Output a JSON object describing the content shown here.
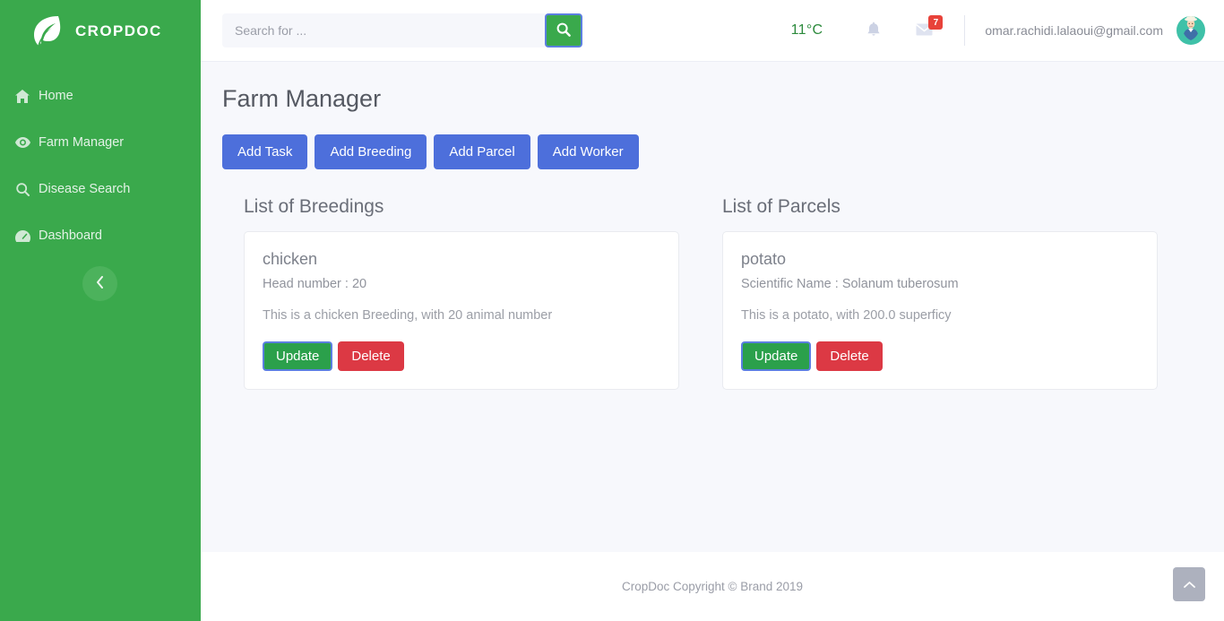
{
  "sidebar": {
    "brand": {
      "name": "CROPDOC",
      "logo_icon": "leaf-icon"
    },
    "items": [
      {
        "label": "Home",
        "icon": "home-icon"
      },
      {
        "label": "Farm Manager",
        "icon": "eye-icon"
      },
      {
        "label": "Disease Search",
        "icon": "search-icon"
      },
      {
        "label": "Dashboard",
        "icon": "dashboard-icon"
      }
    ],
    "collapse_icon": "chevron-left-icon",
    "bg_color": "#3aa94c"
  },
  "topbar": {
    "search": {
      "placeholder": "Search for ...",
      "value": "",
      "button_icon": "search-icon"
    },
    "temperature": "11°C",
    "notifications_icon": "bell-icon",
    "messages_icon": "envelope-icon",
    "messages_badge": "7",
    "user_email": "omar.rachidi.lalaoui@gmail.com",
    "avatar_icon": "farmer-avatar-icon"
  },
  "main": {
    "page_title": "Farm Manager",
    "actions": [
      {
        "label": "Add Task"
      },
      {
        "label": "Add Breeding"
      },
      {
        "label": "Add Parcel"
      },
      {
        "label": "Add Worker"
      }
    ],
    "breedings": {
      "title": "List of Breedings",
      "cards": [
        {
          "name": "chicken",
          "subtitle": "Head number : 20",
          "description": "This is a chicken Breeding, with 20 animal number",
          "update_label": "Update",
          "delete_label": "Delete"
        }
      ]
    },
    "parcels": {
      "title": "List of Parcels",
      "cards": [
        {
          "name": "potato",
          "subtitle": "Scientific Name : Solanum tuberosum",
          "description": "This is a potato, with 200.0 superficy",
          "update_label": "Update",
          "delete_label": "Delete"
        }
      ]
    }
  },
  "footer": {
    "copyright": "CropDoc Copyright © Brand 2019",
    "scroll_top_icon": "chevron-up-icon"
  },
  "colors": {
    "brand_green": "#3aa94c",
    "primary_blue": "#4d6fdb",
    "success_green": "#2ba04b",
    "danger_red": "#dc3944",
    "badge_red": "#e8423a",
    "page_bg": "#f7f8fc"
  }
}
